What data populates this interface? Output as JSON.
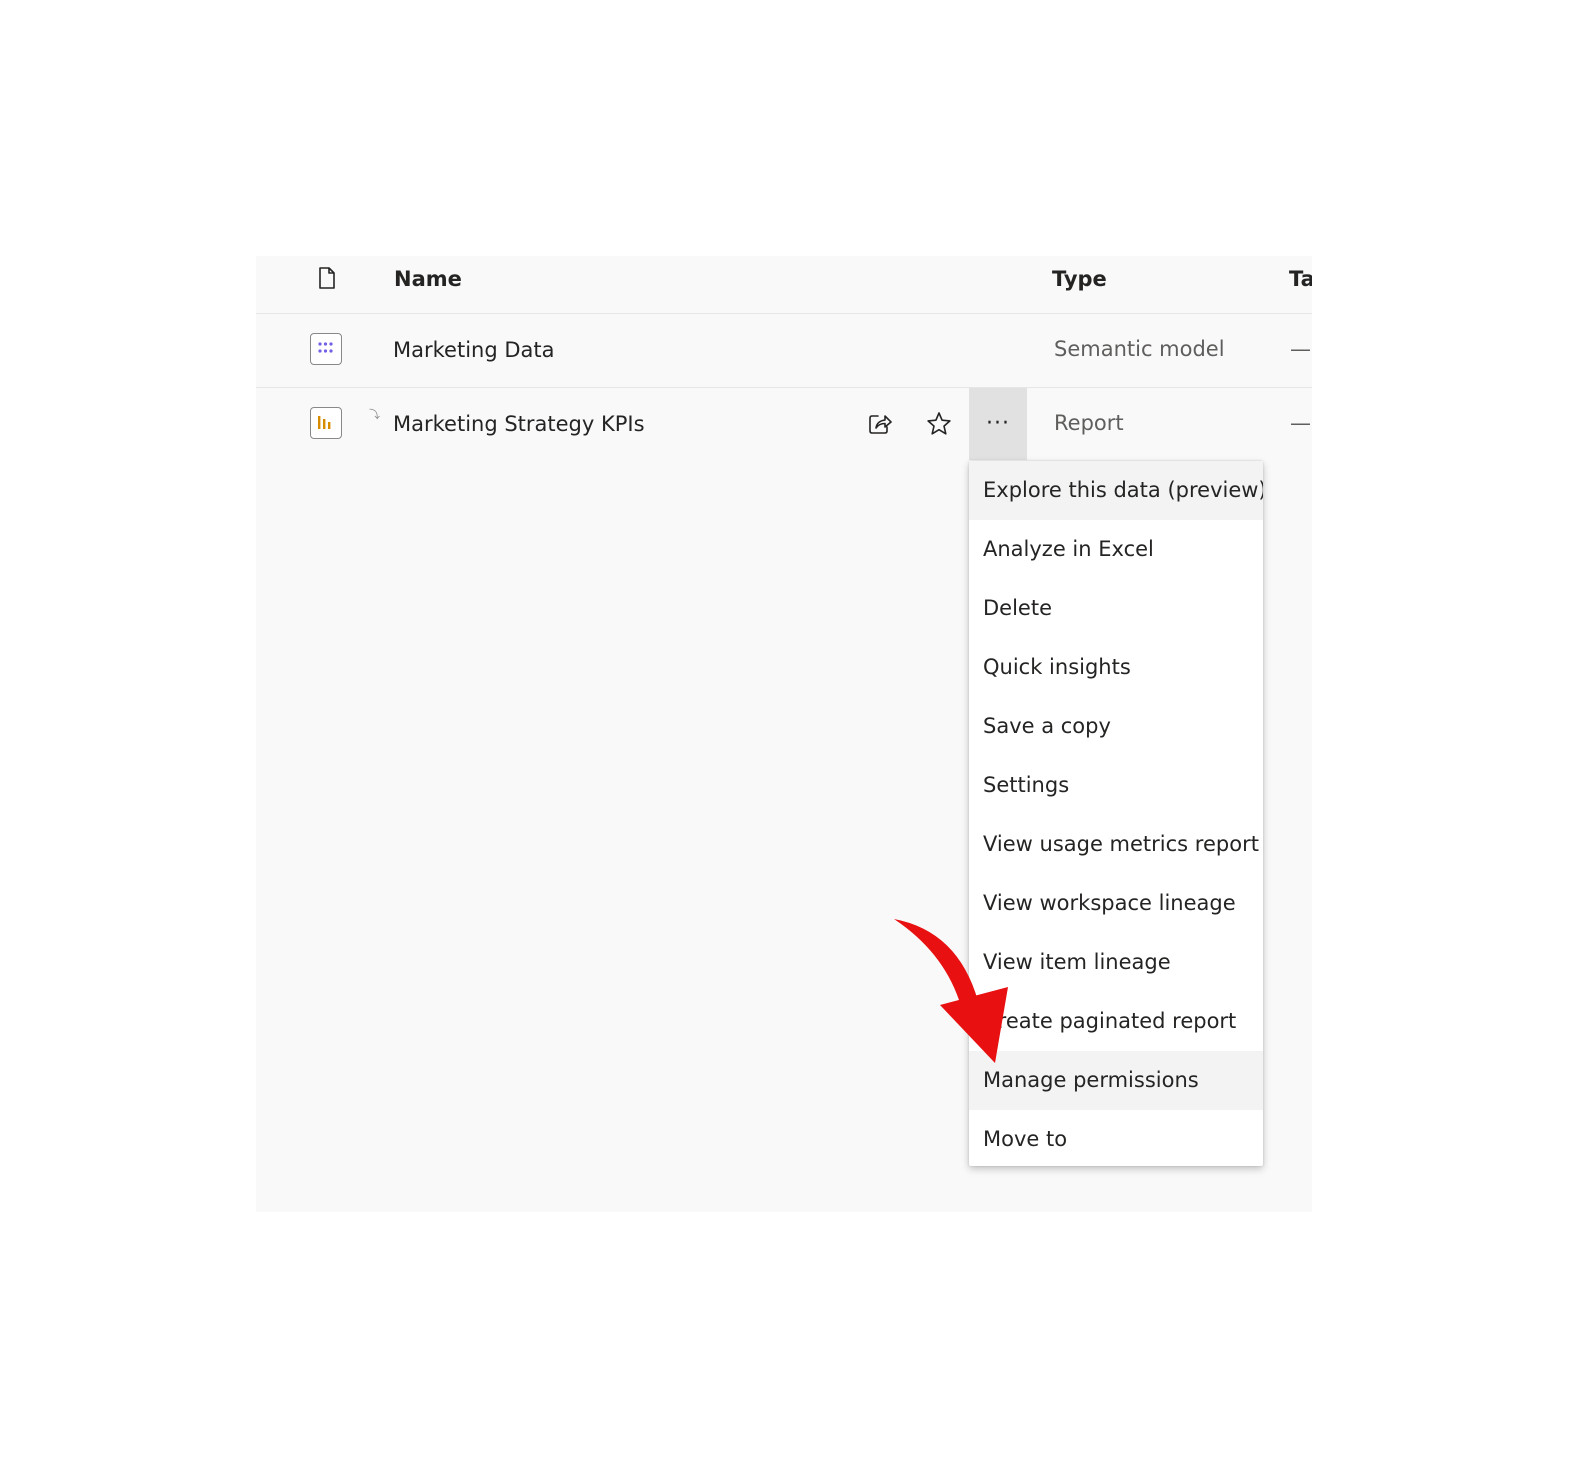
{
  "header": {
    "name_label": "Name",
    "type_label": "Type",
    "tags_label": "Ta"
  },
  "rows": [
    {
      "name": "Marketing Data",
      "type": "Semantic model",
      "tags": "—",
      "icon": "semantic-model-icon"
    },
    {
      "name": "Marketing Strategy KPIs",
      "type": "Report",
      "tags": "—",
      "icon": "report-icon",
      "more_label": "···"
    }
  ],
  "context_menu": {
    "items": [
      "Explore this data (preview)",
      "Analyze in Excel",
      "Delete",
      "Quick insights",
      "Save a copy",
      "Settings",
      "View usage metrics report",
      "View workspace lineage",
      "View item lineage",
      "Create paginated report",
      "Manage permissions",
      "Move to"
    ],
    "highlighted": [
      "Explore this data (preview)",
      "Manage permissions"
    ]
  },
  "annotation": {
    "arrow_color": "#e81010",
    "points_to": "Manage permissions"
  },
  "colors": {
    "panel_bg": "#f9f9f9",
    "semantic_model_accent": "#7160e8",
    "report_accent": "#d68b00",
    "hover_bg": "#e1e1e1"
  }
}
